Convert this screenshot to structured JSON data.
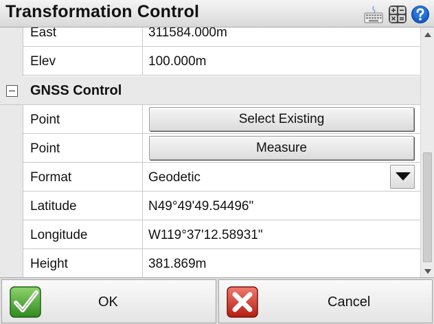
{
  "window": {
    "title": "Transformation Control",
    "icons": [
      "keyboard-icon",
      "calculator-icon",
      "help-icon"
    ]
  },
  "rows": {
    "east": {
      "label": "East",
      "value": "311584.000m"
    },
    "elev": {
      "label": "Elev",
      "value": "100.000m"
    }
  },
  "group": {
    "title": "GNSS Control",
    "rows": {
      "point_select": {
        "label": "Point",
        "button": "Select Existing"
      },
      "point_measure": {
        "label": "Point",
        "button": "Measure"
      },
      "format": {
        "label": "Format",
        "value": "Geodetic"
      },
      "latitude": {
        "label": "Latitude",
        "value": "N49°49'49.54496\""
      },
      "longitude": {
        "label": "Longitude",
        "value": "W119°37'12.58931\""
      },
      "height": {
        "label": "Height",
        "value": "381.869m"
      }
    }
  },
  "buttons": {
    "ok": "OK",
    "cancel": "Cancel"
  },
  "colors": {
    "ok_green": "#3c9a2a",
    "cancel_red": "#d0281e",
    "help_blue": "#1560c8"
  }
}
